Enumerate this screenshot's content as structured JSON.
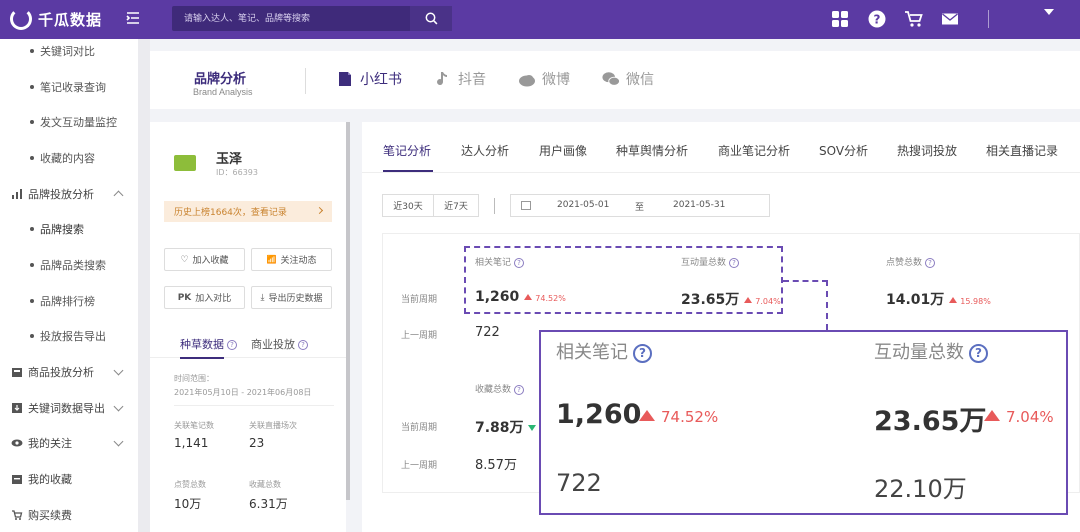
{
  "app": {
    "logo_text": "千瓜数据",
    "accent": "#5b3aa3"
  },
  "search": {
    "placeholder": "请输入达人、笔记、品牌等搜索"
  },
  "sidebar": {
    "items": [
      {
        "label": "关键词对比",
        "kind": "sub"
      },
      {
        "label": "笔记收录查询",
        "kind": "sub"
      },
      {
        "label": "发文互动量监控",
        "kind": "sub"
      },
      {
        "label": "收藏的内容",
        "kind": "sub"
      },
      {
        "label": "品牌投放分析",
        "kind": "group",
        "icon": "chart-icon"
      },
      {
        "label": "品牌搜索",
        "kind": "sub"
      },
      {
        "label": "品牌品类搜索",
        "kind": "sub"
      },
      {
        "label": "品牌排行榜",
        "kind": "sub"
      },
      {
        "label": "投放报告导出",
        "kind": "sub"
      },
      {
        "label": "商品投放分析",
        "kind": "group",
        "icon": "goods-icon"
      },
      {
        "label": "关键词数据导出",
        "kind": "group",
        "icon": "export-icon"
      },
      {
        "label": "我的关注",
        "kind": "group",
        "icon": "eye-icon"
      },
      {
        "label": "我的收藏",
        "kind": "group",
        "icon": "folder-icon"
      },
      {
        "label": "购买续费",
        "kind": "group",
        "icon": "cart-icon"
      }
    ]
  },
  "header": {
    "title": "品牌分析",
    "subtitle": "Brand Analysis",
    "platforms": [
      "小红书",
      "抖音",
      "微博",
      "微信"
    ]
  },
  "profile": {
    "name": "玉泽",
    "id": "ID：66393",
    "history_badge": "历史上榜1664次，查看记录",
    "buttons": {
      "favorite": "加入收藏",
      "follow": "关注动态",
      "compare": "加入对比",
      "export": "导出历史数据"
    },
    "tabs": [
      "种草数据",
      "商业投放"
    ],
    "range_label": "时间范围：",
    "range": "2021年05月10日 - 2021年06月08日",
    "stats": [
      {
        "label": "关联笔记数",
        "value": "1,141"
      },
      {
        "label": "关联直播场次",
        "value": "23"
      },
      {
        "label": "点赞总数",
        "value": "10万"
      },
      {
        "label": "收藏总数",
        "value": "6.31万"
      }
    ]
  },
  "main": {
    "tabs": [
      "笔记分析",
      "达人分析",
      "用户画像",
      "种草舆情分析",
      "商业笔记分析",
      "SOV分析",
      "热搜词投放",
      "相关直播记录"
    ],
    "range_buttons": [
      "近30天",
      "近7天"
    ],
    "date_from": "2021-05-01",
    "date_to_sep": "至",
    "date_to": "2021-05-31",
    "row_labels": {
      "current": "当前周期",
      "previous": "上一周期"
    },
    "metrics": {
      "notes": {
        "title": "相关笔记",
        "value": "1,260",
        "change": "74.52%",
        "prev": "722"
      },
      "interactions": {
        "title": "互动量总数",
        "value": "23.65万",
        "change": "7.04%"
      },
      "likes": {
        "title": "点赞总数",
        "value": "14.01万",
        "change": "15.98%"
      },
      "collects": {
        "title": "收藏总数",
        "value": "7.88万",
        "prev": "8.57万"
      }
    }
  },
  "zoom": {
    "notes_title": "相关笔记",
    "notes_value": "1,260",
    "notes_change": "74.52%",
    "notes_prev": "722",
    "inter_title": "互动量总数",
    "inter_value": "23.65万",
    "inter_change": "7.04%",
    "inter_prev": "22.10万"
  }
}
